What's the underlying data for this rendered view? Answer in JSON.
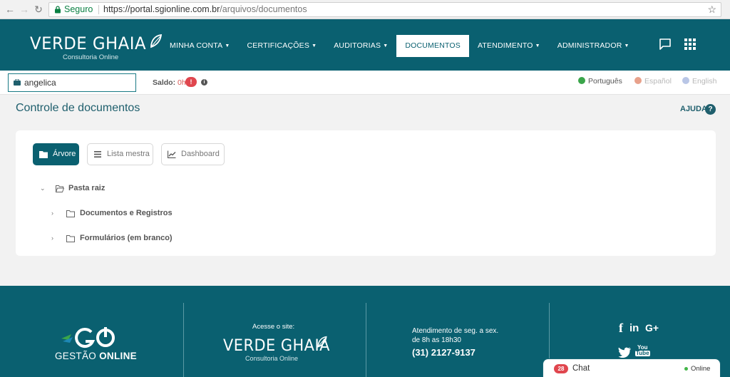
{
  "browser": {
    "secure_label": "Seguro",
    "url_base": "https://portal.sgionline.com.br",
    "url_path": "/arquivos/documentos"
  },
  "brand": {
    "name": "VERDE GHAIA",
    "subtitle": "Consultoria Online"
  },
  "menu": [
    {
      "label": "MINHA CONTA",
      "caret": true,
      "active": false
    },
    {
      "label": "CERTIFICAÇÕES",
      "caret": true,
      "active": false
    },
    {
      "label": "AUDITORIAS",
      "caret": true,
      "active": false
    },
    {
      "label": "DOCUMENTOS",
      "caret": false,
      "active": true
    },
    {
      "label": "ATENDIMENTO",
      "caret": true,
      "active": false
    },
    {
      "label": "ADMINISTRADOR",
      "caret": true,
      "active": false
    }
  ],
  "subbar": {
    "user_value": "angelica",
    "saldo_label": "Saldo:",
    "saldo_value": "0h",
    "saldo_badge": "!",
    "info": "i",
    "languages": [
      {
        "label": "Português",
        "color": "#3aa54a",
        "active": true
      },
      {
        "label": "Español",
        "color": "#e8a18b",
        "active": false
      },
      {
        "label": "English",
        "color": "#b9c6e6",
        "active": false
      }
    ]
  },
  "page": {
    "title": "Controle de documentos",
    "help_label": "AJUDA",
    "help_icon": "?"
  },
  "views": [
    {
      "label": "Árvore",
      "icon": "folder-icon",
      "active": true
    },
    {
      "label": "Lista mestra",
      "icon": "list-icon",
      "active": false
    },
    {
      "label": "Dashboard",
      "icon": "chart-icon",
      "active": false
    }
  ],
  "tree": {
    "root": "Pasta raiz",
    "children": [
      "Documentos e Registros",
      "Formulários (em branco)"
    ]
  },
  "footer": {
    "go_text_1": "GESTÃO",
    "go_text_2": "ONLINE",
    "acesse": "Acesse o site:",
    "atend_line1": "Atendimento de seg. a sex.",
    "atend_line2": "de 8h as 18h30",
    "phone": "(31) 2127-9137",
    "social": {
      "facebook": "f",
      "linkedin": "in",
      "google": "G+",
      "youtube_top": "You",
      "youtube_bottom": "Tube"
    }
  },
  "chat": {
    "count": "28",
    "label": "Chat",
    "status": "Online"
  },
  "colors": {
    "primary": "#0a6070",
    "alert": "#e0464e",
    "online": "#43b649"
  }
}
